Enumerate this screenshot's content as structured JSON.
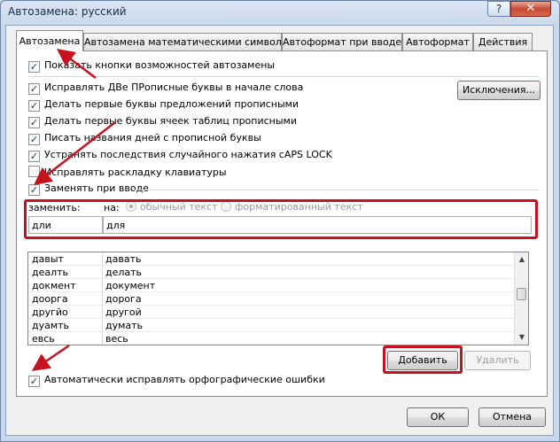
{
  "window": {
    "title": "Автозамена: русский",
    "help_glyph": "?",
    "close_glyph": "✕"
  },
  "tabs": [
    {
      "label": "Автозамена",
      "active": true
    },
    {
      "label": "Автозамена математическими символами",
      "active": false
    },
    {
      "label": "Автоформат при вводе",
      "active": false
    },
    {
      "label": "Автоформат",
      "active": false
    },
    {
      "label": "Действия",
      "active": false
    }
  ],
  "options": {
    "show_buttons": {
      "label": "Показать кнопки возможностей автозамены",
      "checked": true
    },
    "two_caps": {
      "label": "Исправлять ДВе ПРописные буквы в начале слова",
      "checked": true
    },
    "first_letter_sentence": {
      "label": "Делать первые буквы предложений прописными",
      "checked": true
    },
    "first_letter_cell": {
      "label": "Делать первые буквы ячеек таблиц прописными",
      "checked": true
    },
    "day_names": {
      "label": "Писать названия дней с прописной буквы",
      "checked": true
    },
    "caps_lock": {
      "label": "Устранять последствия случайного нажатия cAPS LOCK",
      "checked": true
    },
    "keyboard_layout": {
      "label": "Исправлять раскладку клавиатуры",
      "checked": false
    },
    "replace_as_type": {
      "label": "Заменять при вводе",
      "checked": true
    },
    "auto_spelling": {
      "label": "Автоматически исправлять орфографические ошибки",
      "checked": true
    }
  },
  "exceptions_button": "Исключения...",
  "replace_labels": {
    "replace": "заменить:",
    "with": "на:"
  },
  "format_radios": {
    "plain": "обычный текст",
    "formatted": "форматированный текст",
    "selected": "plain"
  },
  "inputs": {
    "replace_value": "дли",
    "with_value": "для"
  },
  "entries": [
    {
      "from": "давыт",
      "to": "давать"
    },
    {
      "from": "деалть",
      "to": "делать"
    },
    {
      "from": "докмент",
      "to": "документ"
    },
    {
      "from": "доорга",
      "to": "дорога"
    },
    {
      "from": "другйо",
      "to": "другой"
    },
    {
      "from": "дуамть",
      "to": "думать"
    },
    {
      "from": "евсь",
      "to": "весь"
    }
  ],
  "buttons": {
    "add": "Добавить",
    "delete": "Удалить",
    "ok": "ОК",
    "cancel": "Отмена"
  },
  "colors": {
    "highlight": "#c5121e",
    "check": "#1e3a68",
    "title_bar": "#c8d7ea"
  },
  "icons": {
    "scroll_up": "▲",
    "scroll_down": "▼",
    "check": "✓"
  }
}
